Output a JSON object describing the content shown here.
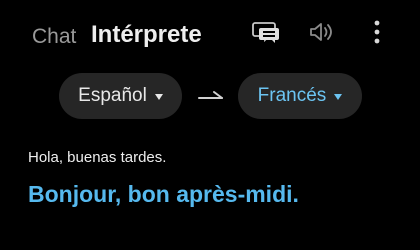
{
  "tabs": {
    "chat_label": "Chat",
    "interpreter_label": "Intérprete"
  },
  "toolbar": {
    "conversation_icon": "chat-bubble-icon",
    "sound_icon": "volume-icon",
    "menu_icon": "more-vertical-icon"
  },
  "languages": {
    "source": "Español",
    "target": "Francés",
    "swap_icon": "arrow-right-icon"
  },
  "translation": {
    "source_text": "Hola, buenas tardes.",
    "target_text": "Bonjour, bon après-midi."
  },
  "colors": {
    "background": "#000000",
    "accent": "#56b9ee",
    "pill": "#262626"
  }
}
